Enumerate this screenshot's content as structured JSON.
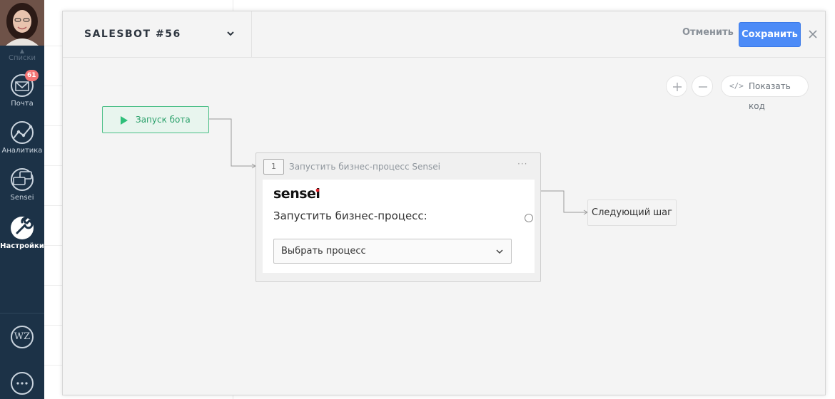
{
  "sidebar": {
    "scroll_label": "Списки",
    "items": [
      {
        "label": "Почта",
        "icon": "mail-icon",
        "badge": "61"
      },
      {
        "label": "Аналитика",
        "icon": "analytics-icon"
      },
      {
        "label": "Sensei",
        "icon": "sensei-icon"
      },
      {
        "label": "Настройки",
        "icon": "settings-icon",
        "active": true
      }
    ],
    "bottom": [
      {
        "label": "WZ",
        "icon": "wz-icon"
      },
      {
        "icon": "chat-icon"
      }
    ]
  },
  "modal": {
    "bot_name": "SALESBOT #56",
    "cancel_label": "Отменить",
    "save_label": "Сохранить",
    "toolbar": {
      "zoom_in_icon": "plus-icon",
      "zoom_out_icon": "minus-icon",
      "code_icon": "</>",
      "show_code_label": "Показать код"
    },
    "start_node": {
      "label": "Запуск бота"
    },
    "step": {
      "number": "1",
      "title": "Запустить бизнес-процесс Sensei",
      "menu": "···",
      "logo_text": "sensei",
      "heading": "Запустить бизнес-процесс:",
      "select_value": "Выбрать процесс"
    },
    "next_step_label": "Следующий шаг"
  },
  "colors": {
    "sidebar_bg": "#1c3247",
    "save_button": "#4c8bf7",
    "start_node_border": "#4cbf87",
    "badge": "#f37575",
    "logo_accent": "#e4242c"
  }
}
